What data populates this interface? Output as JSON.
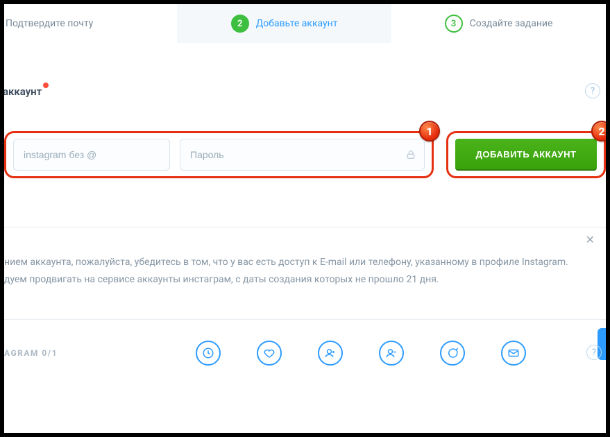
{
  "stepper": {
    "step1": {
      "label": "Подтвердите почту"
    },
    "step2": {
      "num": "2",
      "label": "Добавьте аккаунт"
    },
    "step3": {
      "num": "3",
      "label": "Создайте задание"
    }
  },
  "section": {
    "title": "аккаунт"
  },
  "form": {
    "login_placeholder": "instagram без @",
    "password_placeholder": "Пароль",
    "add_button": "ДОБАВИТЬ АККАУНТ"
  },
  "callouts": {
    "one": "1",
    "two": "2"
  },
  "notice": {
    "line1": "нием аккаунта, пожалуйста, убедитесь в том, что у вас есть доступ к E-mail или телефону, указанному в профиле Instagram.",
    "line2": "дуем продвигать на сервисе аккаунты инстаграм, с даты создания которых не прошло 21 дня."
  },
  "footer": {
    "label": "AGRAM 0/1"
  },
  "help": "?"
}
